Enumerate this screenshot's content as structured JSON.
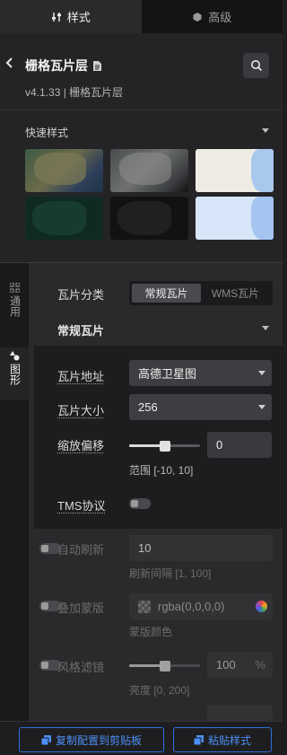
{
  "tabs": [
    {
      "label": "样式",
      "icon": "sliders-icon",
      "active": true
    },
    {
      "label": "高级",
      "icon": "cube-icon",
      "active": false
    }
  ],
  "layer": {
    "title": "栅格瓦片层",
    "subtitle": "v4.1.33 | 栅格瓦片层"
  },
  "quick_style": {
    "title": "快速样式",
    "thumbnails": [
      {
        "name": "satellite",
        "bg": "#4a5a3e"
      },
      {
        "name": "satellite-gray",
        "bg": "#55585a"
      },
      {
        "name": "light-map",
        "bg": "#f0ede6"
      },
      {
        "name": "dark-green",
        "bg": "#123328"
      },
      {
        "name": "black",
        "bg": "#141414"
      },
      {
        "name": "light-blue",
        "bg": "#cfe0f7"
      }
    ]
  },
  "sidebar": {
    "items": [
      {
        "label": "通用",
        "icon": "grid-icon"
      },
      {
        "label": "图形",
        "icon": "shapes-icon"
      }
    ]
  },
  "form": {
    "tile_type": {
      "label": "瓦片分类",
      "options": [
        "常规瓦片",
        "WMS瓦片"
      ],
      "selected": "常规瓦片"
    },
    "section": "常规瓦片",
    "tile_url": {
      "label": "瓦片地址",
      "value": "高德卫星图"
    },
    "tile_size": {
      "label": "瓦片大小",
      "value": "256"
    },
    "zoom_offset": {
      "label": "缩放偏移",
      "value": "0",
      "hint": "范围 [-10, 10]",
      "min": -10,
      "max": 10
    },
    "tms": {
      "label": "TMS协议",
      "on": false
    },
    "auto_refresh": {
      "label": "自动刷新",
      "value": "10",
      "hint": "刷新间隔 [1, 100]",
      "on": false
    },
    "overlay": {
      "label": "叠加蒙版",
      "value": "rgba(0,0,0,0)",
      "hint": "蒙版颜色",
      "on": false
    },
    "filter": {
      "label": "风格滤镜",
      "value": "100",
      "unit": "%",
      "hint": "亮度 [0, 200]",
      "min": 0,
      "max": 200,
      "on": false
    }
  },
  "footer": {
    "copy_label": "复制配置到剪贴板",
    "paste_label": "粘贴样式"
  },
  "colors": {
    "accent": "#2f6fe0",
    "background": "#1e1e20"
  }
}
